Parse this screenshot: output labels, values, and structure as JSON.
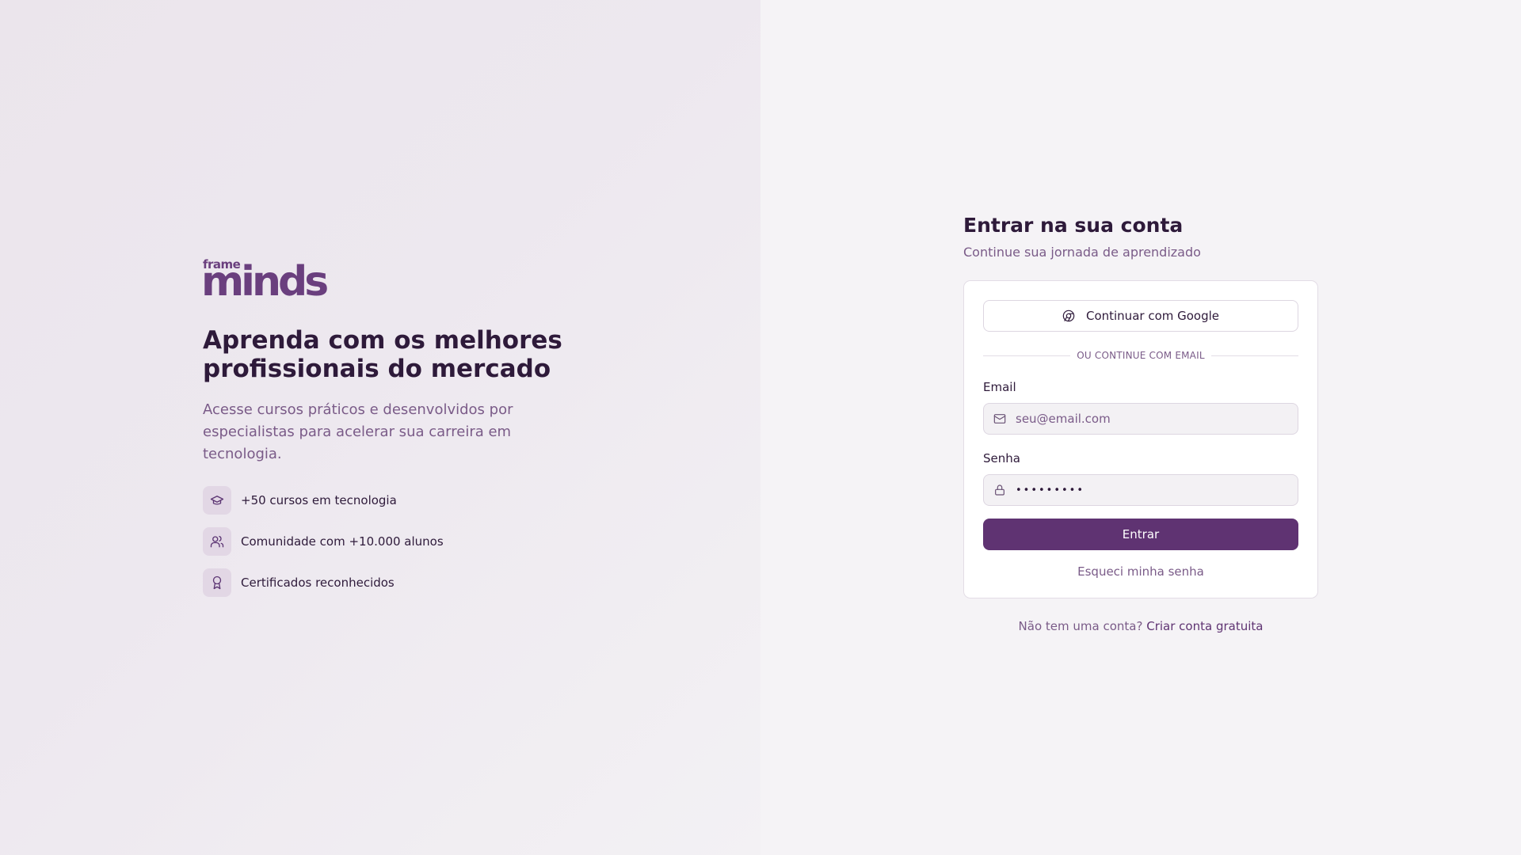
{
  "brand": {
    "logo_small": "frame",
    "logo_big": "minds",
    "logo_color": "#6a3f7e"
  },
  "hero": {
    "title": "Aprenda com os melhores profissionais do mercado",
    "subtitle": "Acesse cursos práticos e desenvolvidos por especialistas para acelerar sua carreira em tecnologia.",
    "features": [
      {
        "icon": "graduation-cap-icon",
        "label": "+50 cursos em tecnologia"
      },
      {
        "icon": "users-icon",
        "label": "Comunidade com +10.000 alunos"
      },
      {
        "icon": "award-icon",
        "label": "Certificados reconhecidos"
      }
    ]
  },
  "login": {
    "title": "Entrar na sua conta",
    "subtitle": "Continue sua jornada de aprendizado",
    "google_button": "Continuar com Google",
    "divider": "OU CONTINUE COM EMAIL",
    "email_label": "Email",
    "email_placeholder": "seu@email.com",
    "password_label": "Senha",
    "password_value": "password1",
    "submit": "Entrar",
    "forgot": "Esqueci minha senha",
    "signup_prompt": "Não tem uma conta?",
    "signup_link": "Criar conta gratuita"
  },
  "colors": {
    "primary": "#5f3372",
    "muted_text": "#7a5b88",
    "text": "#2e1a3a"
  }
}
